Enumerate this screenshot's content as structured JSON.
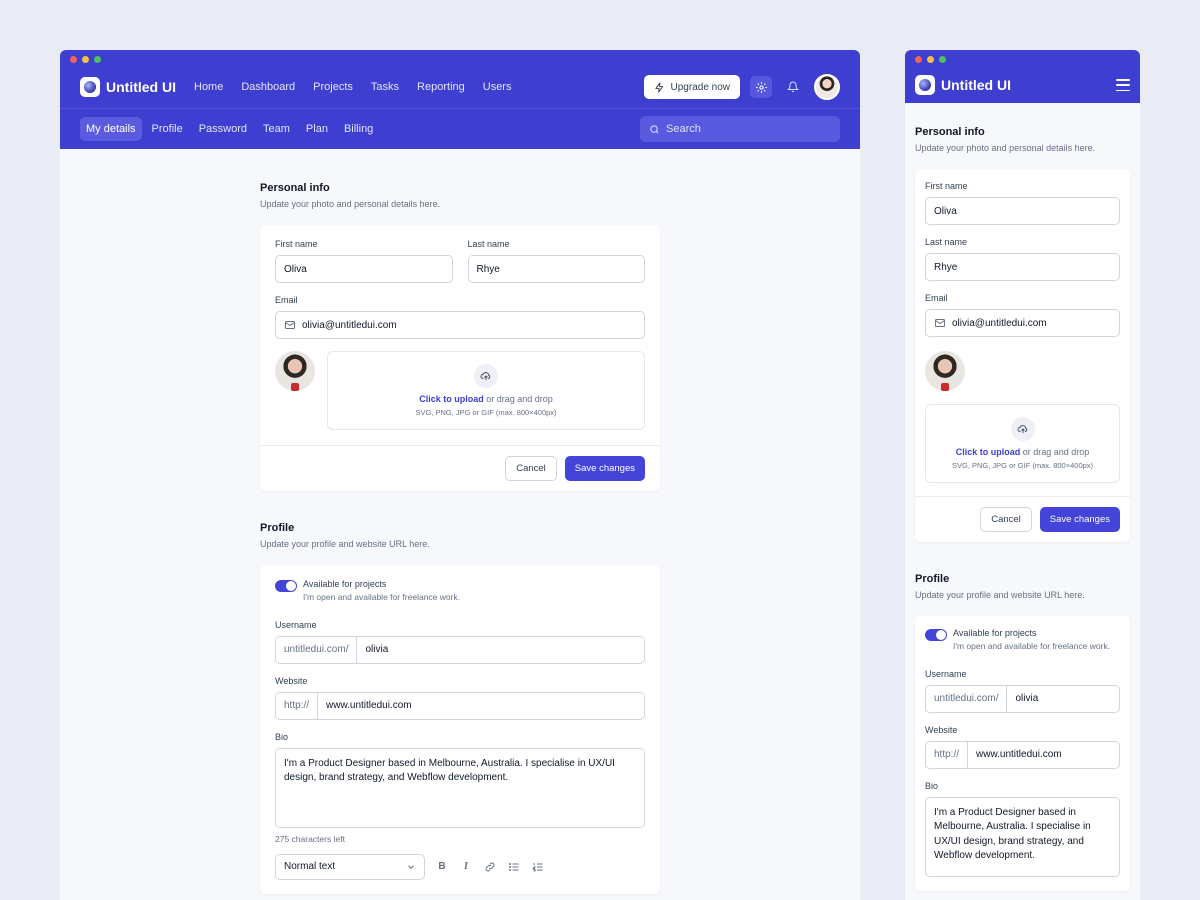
{
  "app": {
    "name": "Untitled UI"
  },
  "nav": [
    "Home",
    "Dashboard",
    "Projects",
    "Tasks",
    "Reporting",
    "Users"
  ],
  "header": {
    "upgrade_label": "Upgrade now"
  },
  "tabs": [
    "My details",
    "Profile",
    "Password",
    "Team",
    "Plan",
    "Billing"
  ],
  "search": {
    "placeholder": "Search"
  },
  "personal": {
    "title": "Personal info",
    "subtitle": "Update your photo and personal details here.",
    "first_name_label": "First name",
    "first_name": "Oliva",
    "last_name_label": "Last name",
    "last_name": "Rhye",
    "email_label": "Email",
    "email": "olivia@untitledui.com",
    "upload_link": "Click to upload",
    "upload_rest": " or drag and drop",
    "upload_hint": "SVG, PNG, JPG or GIF (max. 800×400px)",
    "cancel_label": "Cancel",
    "save_label": "Save changes"
  },
  "profile": {
    "title": "Profile",
    "subtitle": "Update your profile and website URL here.",
    "toggle_title": "Available for projects",
    "toggle_sub": "I'm open and available for freelance work.",
    "toggle_on": true,
    "username_label": "Username",
    "username_prefix": "untitledui.com/",
    "username": "olivia",
    "website_label": "Website",
    "website_prefix": "http://",
    "website": "www.untitledui.com",
    "bio_label": "Bio",
    "bio": "I'm a Product Designer based in Melbourne, Australia. I specialise in UX/UI design, brand strategy, and Webflow development.",
    "chars_left": "275 characters left",
    "text_style": "Normal text"
  },
  "colors": {
    "brand": "#3e3ed0",
    "button_primary": "#4444d9",
    "background": "#e9ecf4"
  }
}
